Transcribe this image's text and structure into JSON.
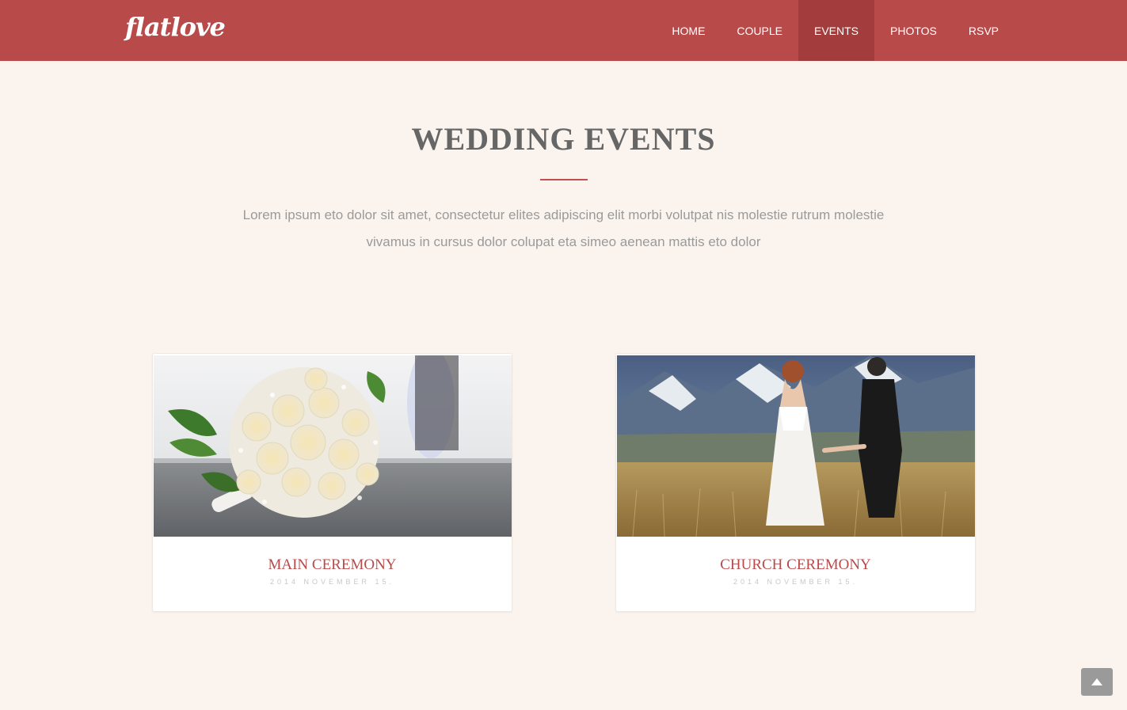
{
  "brand": {
    "logo_text": "flatlove"
  },
  "nav": {
    "items": [
      {
        "label": "HOME"
      },
      {
        "label": "COUPLE"
      },
      {
        "label": "EVENTS",
        "active": true
      },
      {
        "label": "PHOTOS"
      },
      {
        "label": "RSVP"
      }
    ]
  },
  "events_section": {
    "title": "WEDDING EVENTS",
    "intro_line1": "Lorem ipsum eto dolor sit amet, consectetur elites adipiscing elit morbi volutpat nis molestie rutrum molestie",
    "intro_line2": "vivamus in cursus dolor colupat eta simeo aenean mattis eto dolor",
    "cards": [
      {
        "title": "MAIN CEREMONY",
        "date": "2014 NOVEMBER 15.",
        "image": "bridal-bouquet-photo"
      },
      {
        "title": "CHURCH CEREMONY",
        "date": "2014 NOVEMBER 15.",
        "image": "couple-in-field-photo"
      }
    ]
  },
  "back_to_top": {
    "icon": "chevron-up-icon"
  },
  "colors": {
    "brand_red": "#b84a4a",
    "active_nav": "#a33c3c",
    "page_bg": "#fbf4ee",
    "title_gray": "#666666",
    "text_gray": "#9a9a9a"
  }
}
